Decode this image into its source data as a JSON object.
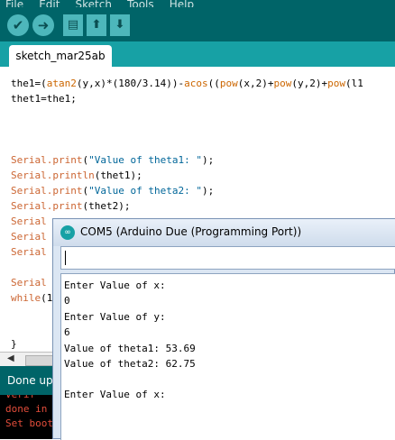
{
  "menu": {
    "items": [
      "File",
      "Edit",
      "Sketch",
      "Tools",
      "Help"
    ]
  },
  "toolbar": {
    "verify_icon": "✔",
    "upload_icon": "➜",
    "new_icon": "▤",
    "open_icon": "⬆",
    "save_icon": "⬇"
  },
  "tab": {
    "label": "sketch_mar25ab"
  },
  "editor": {
    "line1": {
      "a": "the1=(",
      "b": "atan2",
      "c": "(y,x)*(180/3.14))-",
      "d": "acos",
      "e": "((",
      "f": "pow",
      "g": "(x,2)+",
      "h": "pow",
      "i": "(y,2)+",
      "j": "pow",
      "k": "(l1"
    },
    "line2": "thet1=the1;",
    "s1": {
      "obj": "Serial",
      "m": ".print",
      "o": "(",
      "str": "\"Value of theta1: \"",
      "c": ");"
    },
    "s2": {
      "obj": "Serial",
      "m": ".println",
      "rest": "(thet1);"
    },
    "s3": {
      "obj": "Serial",
      "m": ".print",
      "o": "(",
      "str": "\"Value of theta2: \"",
      "c": ");"
    },
    "s4": {
      "obj": "Serial",
      "m": ".print",
      "rest": "(thet2);"
    },
    "s5": "Serial",
    "s6": "Serial",
    "s7": "Serial",
    "s8": "Serial",
    "w": {
      "kw": "while",
      "rest": "(1"
    },
    "brace": "}"
  },
  "status": {
    "text": "Done uplo"
  },
  "console": {
    "lines": [
      "Verif",
      "done in",
      "Set boot"
    ]
  },
  "serial": {
    "title": "COM5 (Arduino Due (Programming Port))",
    "icon": "∞",
    "input_value": "",
    "output": [
      "Enter Value of x:",
      "0",
      "Enter Value of y:",
      "6",
      "Value of theta1: 53.69",
      "Value of theta2: 62.75",
      "",
      "Enter Value of x:"
    ]
  },
  "colors": {
    "teal_dark": "#006468",
    "teal_tab": "#17a1a5",
    "button": "#4db7bb",
    "keyword": "#cc6633",
    "string": "#006699",
    "console_text": "#e34d3b"
  }
}
